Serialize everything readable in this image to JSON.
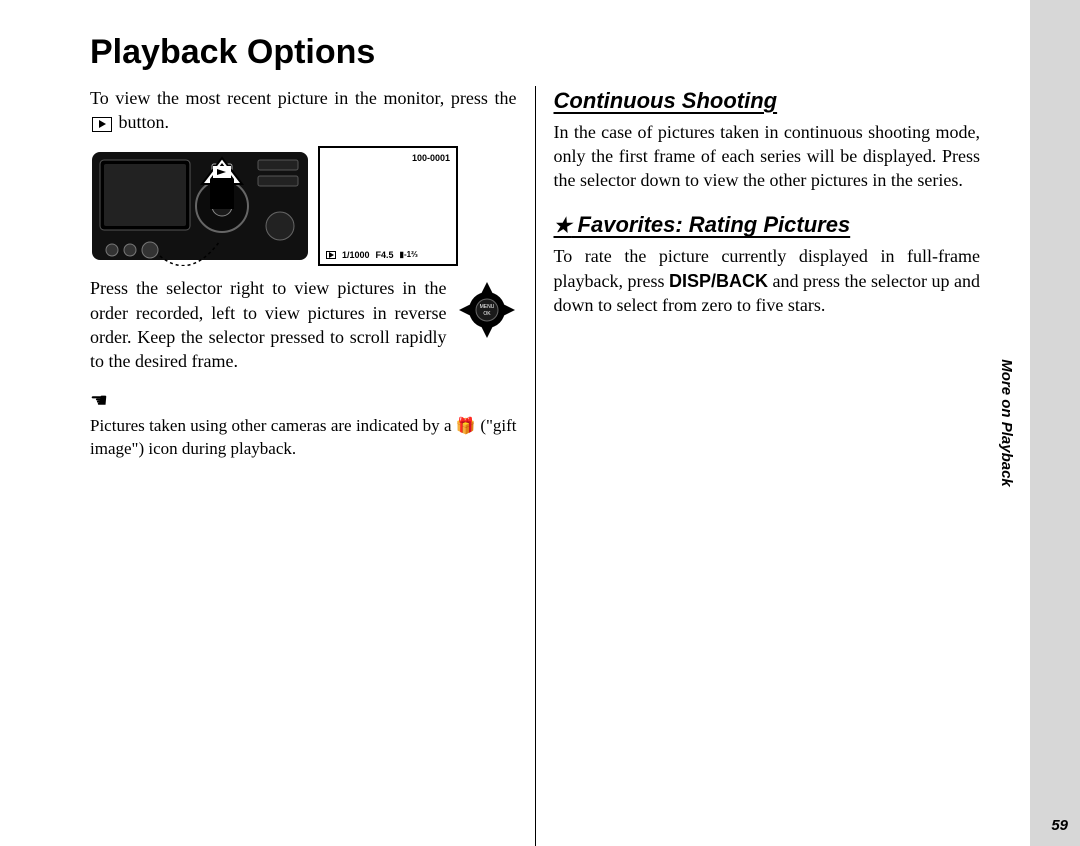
{
  "title": "Playback Options",
  "sidebar_label": "More on Playback",
  "page_number": "59",
  "left": {
    "intro_a": "To view the most recent picture in the monitor, press the ",
    "intro_b": " button.",
    "screen_top": "100-0001",
    "screen_shutter": "1/1000",
    "screen_ap": "F4.5",
    "screen_exp": "-1⅔",
    "selector_para": "Press the selector right to view pictures in the order recorded, left to view pictures in reverse order. Keep the selector pressed to scroll rapidly to the desired frame.",
    "selector_menu": "MENU",
    "selector_ok": "OK",
    "note_a": "Pictures taken using other cameras are indicated by a ",
    "note_b": " (\"gift image\") icon during playback.",
    "gift_glyph": "🎁"
  },
  "right": {
    "h1": "Continuous Shooting",
    "p1": "In the case of pictures taken in continuous shooting mode, only the first frame of each series will be displayed. Press the selector down to view the other pictures in the series.",
    "star_glyph": "★",
    "h2": " Favorites: Rating Pictures",
    "p2_a": "To rate the picture currently displayed in full-frame playback, press ",
    "disp_back": "DISP/BACK",
    "p2_b": " and press the selector up and down to select from zero to five stars."
  }
}
